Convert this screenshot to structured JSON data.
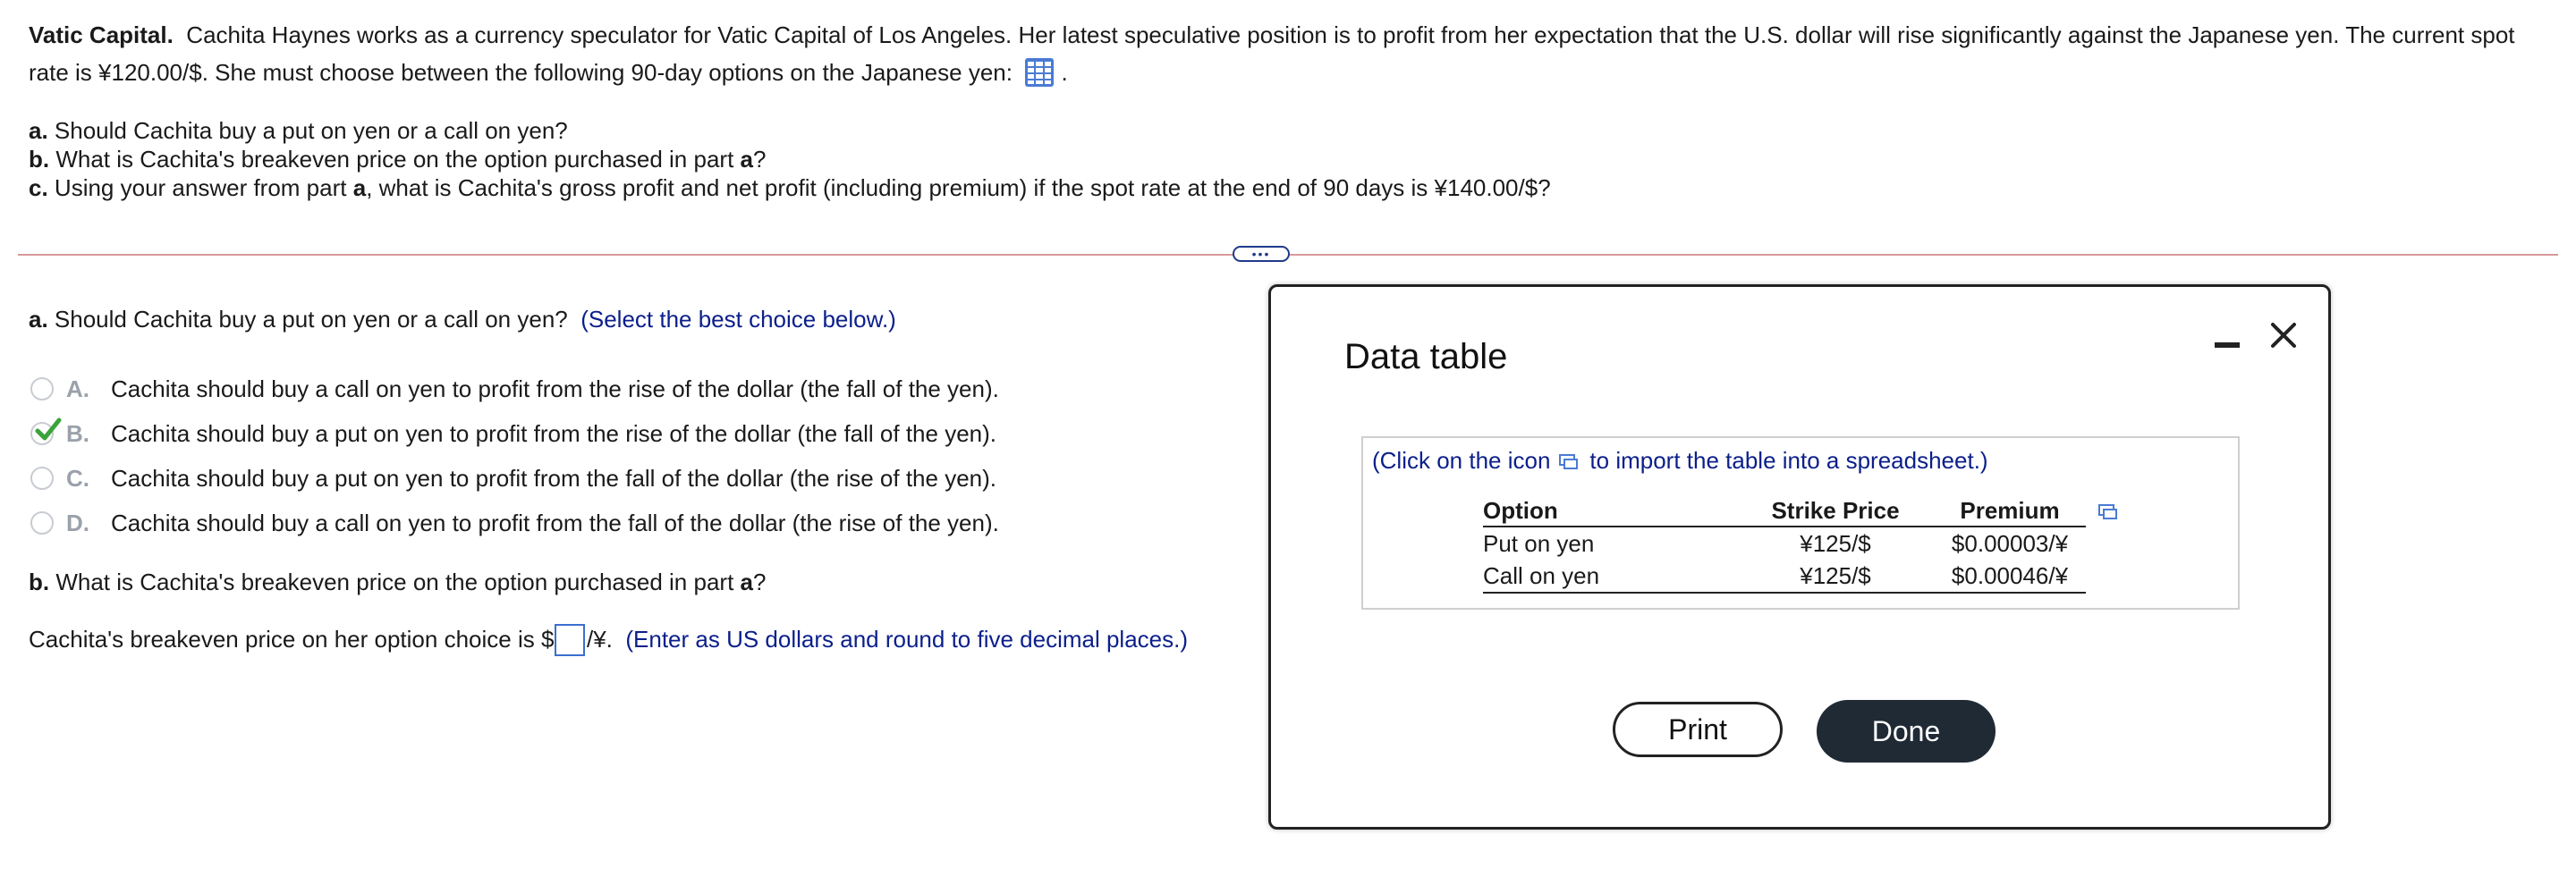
{
  "problem": {
    "title": "Vatic Capital.",
    "body": "Cachita Haynes works as a currency speculator for Vatic Capital of Los Angeles. Her latest speculative position is to profit from her expectation that the U.S. dollar will rise significantly against the Japanese yen. The current spot rate is ¥120.00/$. She must choose between the following 90-day options on the Japanese yen:",
    "after_icon": ".",
    "table_icon": "grid-table-icon"
  },
  "questions": {
    "a_label": "a.",
    "a_text": "Should Cachita buy a put on yen or a call on yen?",
    "b_label": "b.",
    "b_text_1": "What is Cachita's breakeven price on the option purchased in part",
    "b_text_bold": "a",
    "b_text_2": "?",
    "c_label": "c.",
    "c_text_1": "Using your answer from part",
    "c_text_bold": "a",
    "c_text_2": ", what is Cachita's gross profit and net profit (including premium) if the spot rate at the end of 90 days is ¥140.00/$?"
  },
  "divider": {
    "more_label": "•••"
  },
  "part_a": {
    "label": "a.",
    "question": "Should Cachita buy a put on yen or a call on yen?",
    "instruction": "(Select the best choice below.)",
    "options": [
      {
        "letter": "A.",
        "text": "Cachita should buy a call on yen to profit from the rise of the dollar (the fall of the yen).",
        "selected": false
      },
      {
        "letter": "B.",
        "text": "Cachita should buy a put on yen to profit from the rise of the dollar (the fall of the yen).",
        "selected": true
      },
      {
        "letter": "C.",
        "text": "Cachita should buy a put on yen to profit from the fall of the dollar (the rise of the yen).",
        "selected": false
      },
      {
        "letter": "D.",
        "text": "Cachita should buy a call on yen to profit from the fall of the dollar (the rise of the yen).",
        "selected": false
      }
    ],
    "check_color": "#3aa33a"
  },
  "part_b": {
    "label": "b.",
    "question_1": "What is Cachita's breakeven price on the option purchased in part",
    "question_bold": "a",
    "question_2": "?",
    "answer_prefix": "Cachita's breakeven price on her option choice is $",
    "answer_value": "",
    "answer_suffix": "/¥.",
    "instruction": "(Enter as US dollars and round to five decimal places.)"
  },
  "modal": {
    "title": "Data table",
    "minimize_icon": "minimize-icon",
    "close_icon": "close-icon",
    "hint_before": "(Click on the icon",
    "hint_after": "to import the table into a spreadsheet.)",
    "table": {
      "headers": [
        "Option",
        "Strike Price",
        "Premium"
      ],
      "rows": [
        [
          "Put on yen",
          "¥125/$",
          "$0.00003/¥"
        ],
        [
          "Call on yen",
          "¥125/$",
          "$0.00046/¥"
        ]
      ]
    },
    "print_label": "Print",
    "done_label": "Done"
  },
  "colors": {
    "accent_blue": "#0b1f8a",
    "divider": "#d99a9a",
    "done_button": "#1f2a35"
  }
}
